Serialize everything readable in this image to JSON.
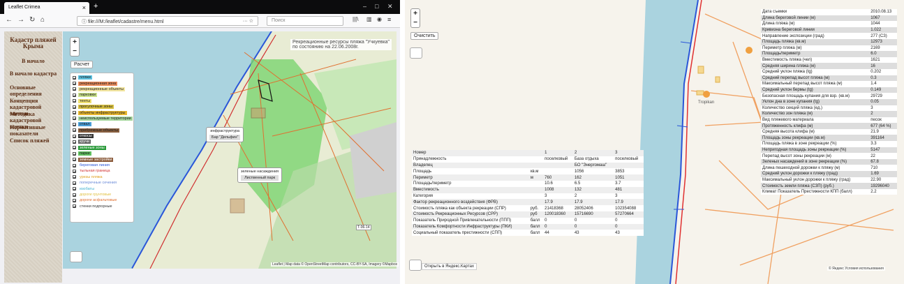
{
  "browser": {
    "tab_title": "Leaflet Crimea",
    "url": "file:///M:/leaflet/cadastre/menu.html",
    "search_placeholder": "Поиск"
  },
  "sidebar": {
    "title": "Кадастр пляжей Крыма",
    "items": [
      "В начало",
      "В начало кадастра",
      "Основные определения",
      "Концепция кадастровой оценки",
      "Методика кадастровой оценки",
      "Нормативные показатели",
      "Список пляжей"
    ]
  },
  "left_map": {
    "zoom_in": "+",
    "zoom_out": "−",
    "calc_button": "Расчет",
    "banner_line1": "Рекреационные ресурсы пляжа \"Учкуевка\"",
    "banner_line2": "по состоянию на 22.06.2008г.",
    "legend": [
      {
        "label": "пляжи",
        "bg": "#5bc0de"
      },
      {
        "label": "рекреационная зона",
        "bg": "#e88a5a"
      },
      {
        "label": "рекреационные объекты",
        "bg": "#f3e6a0"
      },
      {
        "label": "парковки",
        "bg": "#c9e08a"
      },
      {
        "label": "тенты",
        "bg": "#f0e070"
      },
      {
        "label": "прогулочные зоны",
        "bg": "#d8c040"
      },
      {
        "label": "объекты инфраструктуры",
        "bg": "#e8b830"
      },
      {
        "label": "неиспользуемые территории",
        "bg": "#a8d8a0"
      },
      {
        "label": "отвал",
        "bg": "#4a9fd8"
      },
      {
        "label": "прибрежные объекты",
        "bg": "#8a6040"
      },
      {
        "label": "откосы",
        "bg": "#333",
        "fg": "#fff"
      },
      {
        "label": "кручи",
        "bg": "#666",
        "fg": "#fff"
      },
      {
        "label": "зеленые зоны",
        "bg": "#2a9a3a",
        "fg": "#fff"
      },
      {
        "label": "парки",
        "bg": "#60c060"
      },
      {
        "label": "земные застройки",
        "bg": "#8a5a3a",
        "fg": "#fff"
      },
      {
        "label": "береговая линия",
        "bg": "#fff",
        "fg": "#2a56d8"
      },
      {
        "label": "тыльная граница",
        "bg": "#fff",
        "fg": "#d03030"
      },
      {
        "label": "урезы пляжа",
        "bg": "#fff",
        "fg": "#e0a020"
      },
      {
        "label": "поперечные сечения",
        "bg": "#fff",
        "fg": "#6a8ad8"
      },
      {
        "label": "изобаты",
        "bg": "#fff",
        "fg": "#40b0d0"
      },
      {
        "label": "дороги грунтовые",
        "bg": "#fff",
        "fg": "#e0c040"
      },
      {
        "label": "дороги асфальтовые",
        "bg": "#fff",
        "fg": "#e07030"
      },
      {
        "label": "стенки подпорные",
        "bg": "#fff",
        "fg": "#333"
      }
    ],
    "popup1_title": "инфраструктура",
    "popup1_value": "Бар \"Дельфин\"",
    "popup2_title": "зеленые насаждения",
    "popup2_value": "Лиственный парк",
    "attribution": "Leaflet | Map data © OpenStreetMap contributors, CC-BY-SA, Imagery ©Mapbox",
    "road_label": "Т-06-14"
  },
  "right_map": {
    "clear_button": "Очистить",
    "yandex_link": "Открыть в Яндекс.Картах",
    "poi_label": "Tropikan",
    "yandex_footer": "© Яндекс  Условия использования",
    "table1": [
      [
        "Номер",
        "",
        "1",
        "2",
        "3"
      ],
      [
        "Принадлежность",
        "",
        "поселковый",
        "База отдыха",
        "поселковый"
      ],
      [
        "Владелец",
        "",
        "",
        "БО \"Энергомаш\"",
        ""
      ],
      [
        "Площадь",
        "кв.м",
        "",
        "1056",
        "3853"
      ],
      [
        "Периметр",
        "м",
        "760",
        "162",
        "1051"
      ],
      [
        "Площадь/периметр",
        "",
        "10.6",
        "6.5",
        "3.7"
      ],
      [
        "Вместимость",
        "",
        "1008",
        "132",
        "481"
      ],
      [
        "Категория",
        "",
        "3",
        "2",
        "3"
      ],
      [
        "Фактор рекреационного воздействия (ФРВ)",
        "",
        "17.9",
        "17.9",
        "17.9"
      ],
      [
        "Стоимость пляжа как объекта рекреации (СПР)",
        "руб.",
        "21418368",
        "28052406",
        "102354088"
      ],
      [
        "Стоимость Рекреационных Ресурсов (СРР)",
        "руб",
        "120018360",
        "15716690",
        "57270664"
      ],
      [
        "Показатель Природной Привлекательности (ППП)",
        "балл",
        "0",
        "0",
        "0"
      ],
      [
        "Показатель Комфортности Инфраструктуры (ПКИ)",
        "балл",
        "0",
        "0",
        "0"
      ],
      [
        "Социальный показатель престижности (СПП)",
        "балл",
        "44",
        "43",
        "43"
      ]
    ],
    "table2": [
      [
        "Дата съемки",
        "2010.08.13"
      ],
      [
        "Длина береговой линии (м)",
        "1067"
      ],
      [
        "Длина пляжа (м)",
        "1044"
      ],
      [
        "Кривизна береговой линии",
        "1.022"
      ],
      [
        "Направление экспозиции (град)",
        "277 (СЗ)"
      ],
      [
        "Площадь пляжа (кв.м)",
        "12973"
      ],
      [
        "Периметр пляжа (м)",
        "2169"
      ],
      [
        "Площадь/периметр",
        "6.0"
      ],
      [
        "Вместимость пляжа (чел)",
        "1621"
      ],
      [
        "Средняя ширина пляжа (м)",
        "16"
      ],
      [
        "Средний уклон пляжа (tg)",
        "0.202"
      ],
      [
        "Средний перепад высот пляжа (м)",
        "0.3"
      ],
      [
        "Максимальный перепад высот пляжа (м)",
        "1.4"
      ],
      [
        "Средний уклон бермы (tg)",
        "0.149"
      ],
      [
        "Безопасная площадь купания для взр. (кв.м)",
        "29729"
      ],
      [
        "Уклон дна в зоне купания (tg)",
        "0.05"
      ],
      [
        "Количество секций пляжа (ед.)",
        "3"
      ],
      [
        "Количество зон пляжа (м)",
        "2"
      ],
      [
        "Вид пляжевого материала",
        "песок"
      ],
      [
        "Протяженность клифа (м)",
        "677  (64 %)"
      ],
      [
        "Средняя высота клифа (м)",
        "21.9"
      ],
      [
        "Площадь зоны рекреации (кв.м)",
        "391164"
      ],
      [
        "Площадь пляжа в зоне рекреации (%)",
        "3.3"
      ],
      [
        "Непригодная площадь зоны рекреации (%)",
        "5147"
      ],
      [
        "Перепад высот зоны рекреации (м)",
        "22"
      ],
      [
        "Зеленых насаждений в зоне рекреации (%)",
        "67.8"
      ],
      [
        "Длина пешеходной дорожки к пляжу (м)",
        "710"
      ],
      [
        "Средний уклон дорожки к пляжу (град)",
        "1.69"
      ],
      [
        "Максимальный уклон дорожки к пляжу (град)",
        "22.90"
      ],
      [
        "Стоимость земли пляжа (СЗП) (руб.)",
        "19296040"
      ],
      [
        "Климат Показатель Престижности КПП (балл)",
        "2.2"
      ]
    ]
  }
}
